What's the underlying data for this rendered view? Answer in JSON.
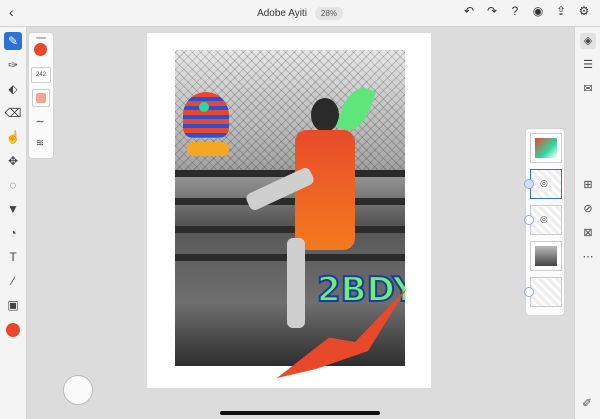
{
  "header": {
    "back_icon": "chevron-left-icon",
    "title": "Adobe Ayiti",
    "zoom": "28%",
    "icons": [
      "undo-icon",
      "redo-icon",
      "help-icon",
      "account-icon",
      "share-icon",
      "gear-icon"
    ]
  },
  "left_tools": [
    "brush-icon",
    "pixel-brush-icon",
    "fill-icon",
    "eraser-icon",
    "smudge-icon",
    "move-icon",
    "lasso-icon",
    "paint-bucket-icon",
    "shape-icon",
    "text-icon",
    "eyedropper-icon",
    "image-icon"
  ],
  "brush_panel": {
    "size": "242"
  },
  "colors": {
    "accent": "#2d72d9",
    "primary_color": "#e8492b"
  },
  "graffiti_text": "2BDY",
  "right_tools": [
    "layers-icon",
    "properties-icon",
    "comments-icon"
  ],
  "layer_actions": [
    "add-layer-icon",
    "hide-layer-icon",
    "delete-layer-icon",
    "more-icon"
  ]
}
